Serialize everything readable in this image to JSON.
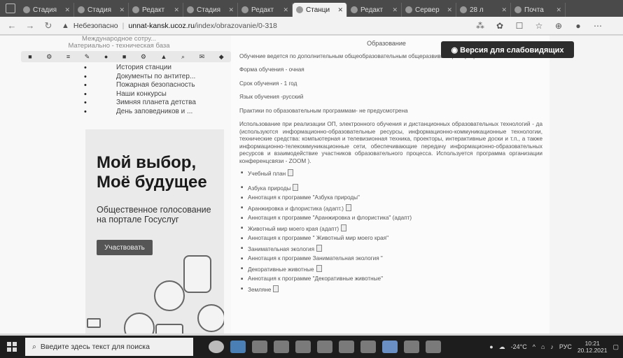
{
  "browser": {
    "tabs": [
      {
        "label": "Стадия"
      },
      {
        "label": "Стадия"
      },
      {
        "label": "Редакт"
      },
      {
        "label": "Стадия"
      },
      {
        "label": "Редакт"
      },
      {
        "label": "Станци",
        "active": true
      },
      {
        "label": "Редакт"
      },
      {
        "label": "Сервер"
      },
      {
        "label": "28 л"
      },
      {
        "label": "Почта"
      }
    ],
    "security_label": "Небезопасно",
    "url_domain": "unnat-kansk.ucoz.ru",
    "url_path": "/index/obrazovanie/0-318"
  },
  "accessibility_button": "◉ Версия для слабовидящих",
  "sidebar": {
    "top_items": [
      "Международное сотру...",
      "Материально - техническая база"
    ],
    "items": [
      "История станции",
      "Документы по антитер...",
      "Пожарная безопасность",
      "Наши конкурсы",
      "Зимняя планета детства",
      "День заповедников и ..."
    ]
  },
  "banner": {
    "title_line1": "Мой выбор,",
    "title_line2": "Моё будущее",
    "subtitle": "Общественное голосование на портале Госуслуг",
    "button": "Участвовать"
  },
  "main": {
    "heading": "Образование",
    "intro": "Обучение ведется по дополнительным общеобразовательным общеразвивающим программам",
    "form": "Форма обучения - очная",
    "term": "Срок обучения - 1 год",
    "language": "Язык обучения -русский",
    "accreditation": "Практики по образовательным программам- не предусмотрена",
    "technology": "Использование при реализации ОП, электронного обучения и дистанционных образовательных технологий - да (используются информационно-образовательные ресурсы, информационно-коммуникационные технологии, технические средства: компьютерная и телевизионная техника, проекторы, интерактивные доски и т.п., а также информационно-телекоммуникационные сети, обеспечивающие передачу информационно-образовательных ресурсов и взаимодействие участников образовательного процесса. Используется программа организации конференцсвязи - ZOOM ).",
    "docs": [
      {
        "label": "Учебный план",
        "icon": true
      },
      {
        "label": "Азбука природы",
        "icon": true,
        "gap": true
      },
      {
        "label": "Аннотация к программе \"Азбука природы\""
      },
      {
        "label": "Аранжировка и флористика (адапт.)",
        "icon": true
      },
      {
        "label": "Аннотация к программе \"Аранжировка и флористика\" (адапт)"
      },
      {
        "label": "Животный мир моего края (адапт)",
        "icon": true
      },
      {
        "label": "Аннотация к программе \" Животный мир моего края\""
      },
      {
        "label": "Занимательная экология",
        "icon": true
      },
      {
        "label": "Аннотация к программе Занимательная экология \""
      },
      {
        "label": "Декоративные животные",
        "icon": true
      },
      {
        "label": "Аннотация к программе \"Декоративные животные\""
      },
      {
        "label": "Земляне",
        "icon": true
      }
    ]
  },
  "taskbar": {
    "search_placeholder": "Введите здесь текст для поиска",
    "weather": "-24°C",
    "lang": "РУС",
    "time": "10:21",
    "date": "20.12.2021"
  }
}
